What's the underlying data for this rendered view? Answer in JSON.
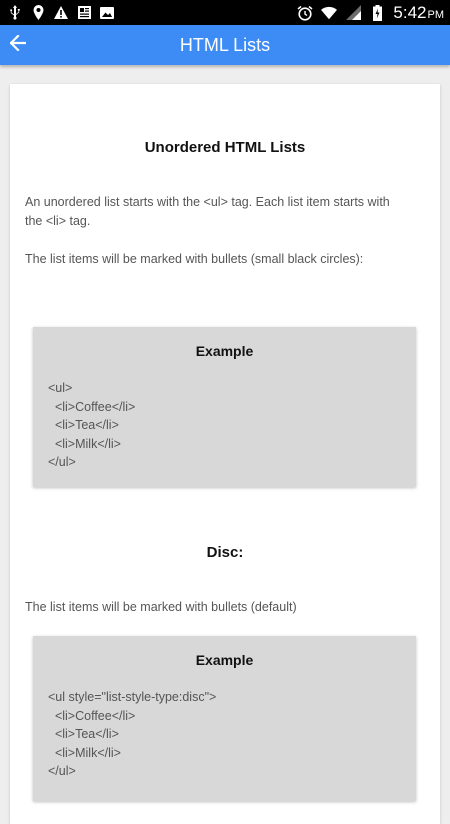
{
  "status_bar": {
    "time": "5:42",
    "ampm": "PM",
    "icons": [
      "usb-icon",
      "location-icon",
      "warning-icon",
      "news-icon",
      "photo-icon",
      "alarm-icon",
      "wifi-icon",
      "signal-icon",
      "battery-icon"
    ]
  },
  "app_bar": {
    "title": "HTML Lists",
    "back_icon": "arrow-left-icon",
    "color": "#3d8cf6"
  },
  "content": {
    "heading": "Unordered HTML Lists",
    "para1_line1": "An unordered list starts with the <ul> tag. Each list item starts with",
    "para1_line2": "the <li> tag.",
    "para2": "The list items will be marked with bullets (small black circles):",
    "example1": {
      "title": "Example",
      "lines": [
        "<ul>",
        "  <li>Coffee</li>",
        "  <li>Tea</li>",
        "  <li>Milk</li>",
        "</ul>"
      ]
    },
    "disc_heading": "Disc:",
    "disc_para": "The list items will be marked with bullets (default)",
    "example2": {
      "title": "Example",
      "lines": [
        "<ul style=\"list-style-type:disc\">",
        "  <li>Coffee</li>",
        "  <li>Tea</li>",
        "  <li>Milk</li>",
        "</ul>"
      ]
    }
  }
}
